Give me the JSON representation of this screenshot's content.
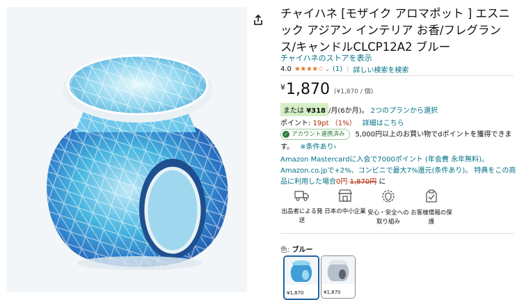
{
  "product": {
    "title": "チャイハネ [モザイク アロマポット ] エスニック アジアン インテリア お香/フレグランス/キャンドルCLCP12A2 ブルー",
    "store_link": "チャイハネのストアを表示",
    "rating_value": "4.0",
    "stars": "★★★★☆",
    "review_count": "(1)",
    "search_link": "詳しい検索を検索"
  },
  "price": {
    "yen_symbol": "¥",
    "amount": "1,870",
    "unit_price": "(¥1,870 / 個)",
    "installment_prefix": "または",
    "installment_amount": "¥318",
    "installment_suffix": "/月(6か月)。",
    "plans_link": "2つのプランから選択"
  },
  "points": {
    "label": "ポイント: ",
    "value": "19pt （1%）",
    "details_link": "詳細はこちら"
  },
  "dpoint": {
    "badge": "アカウント連携済み",
    "text": "5,000円以上のお買い物でdポイントを獲得できます。",
    "conditions_link": "※条件あり›"
  },
  "mastercard": {
    "line1": "Amazon Mastercardに入会で7000ポイント (年会費 永年無料)。",
    "line2": "Amazon.co.jpで+2%、コンビニで最大7%還元(条件あり)。 特典をこの商品に利用した場合",
    "new_price": "0円",
    "old_price": "1,870円",
    "suffix": "に"
  },
  "features": [
    {
      "icon": "truck-icon",
      "label": "出品者による発送"
    },
    {
      "icon": "shop-icon",
      "label": "日本の中小企業"
    },
    {
      "icon": "shield-icon",
      "label": "安心・安全への取り組み"
    },
    {
      "icon": "clipboard-check-icon",
      "label": "お客様情報の保護"
    }
  ],
  "color": {
    "label": "色: ",
    "selected": "ブルー",
    "options": [
      {
        "price": "¥1,870"
      },
      {
        "price": "¥1,870"
      }
    ]
  },
  "colors": {
    "link": "#007185",
    "price_red": "#b12704",
    "star": "#de7921",
    "selected_border": "#2162a1"
  }
}
